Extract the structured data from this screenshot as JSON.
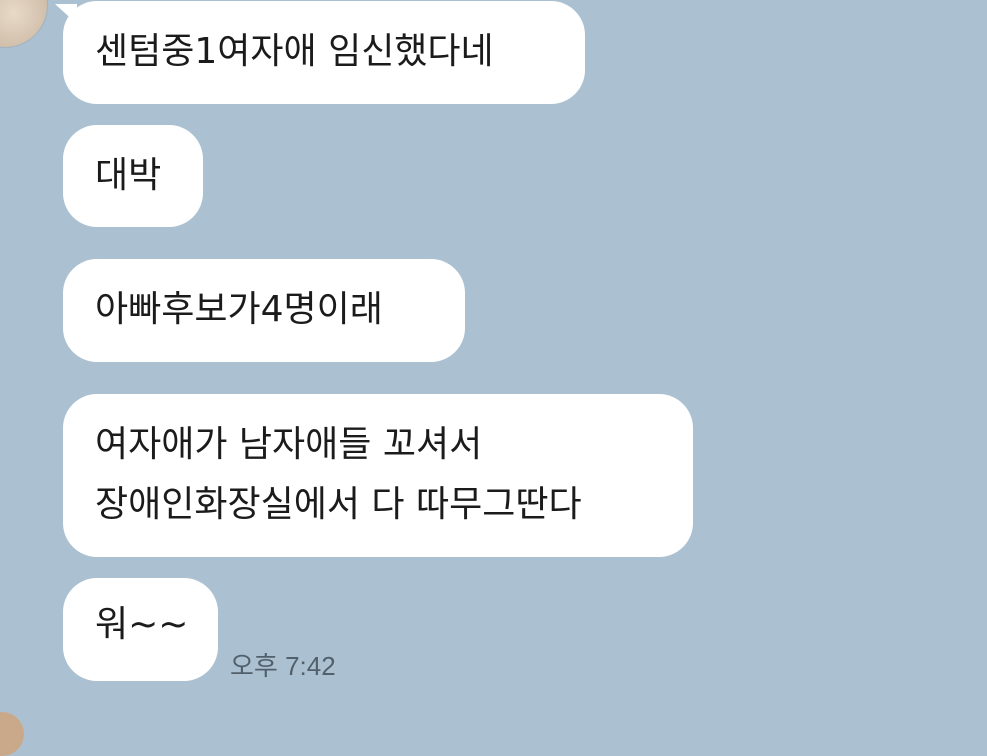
{
  "chat": {
    "messages": [
      {
        "lines": [
          "센텀중1여자애 임신했다네"
        ]
      },
      {
        "lines": [
          "대박"
        ]
      },
      {
        "lines": [
          "아빠후보가4명이래"
        ]
      },
      {
        "lines": [
          "여자애가 남자애들 꼬셔서",
          "장애인화장실에서 다 따무그딴다"
        ]
      },
      {
        "lines": [
          "워~~"
        ]
      }
    ],
    "timestamp": "오후 7:42"
  },
  "colors": {
    "background": "#abc1d1",
    "bubble": "#ffffff",
    "text": "#1b1b1b",
    "timestamp": "#52606c"
  }
}
